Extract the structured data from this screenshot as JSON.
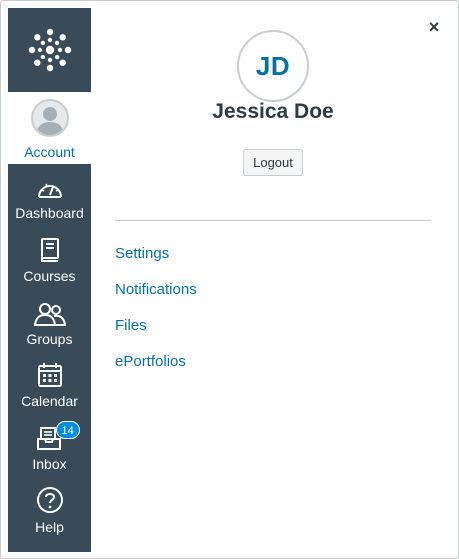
{
  "nav": {
    "account_label": "Account",
    "items": [
      {
        "label": "Dashboard",
        "icon": "dashboard-icon"
      },
      {
        "label": "Courses",
        "icon": "courses-icon"
      },
      {
        "label": "Groups",
        "icon": "groups-icon"
      },
      {
        "label": "Calendar",
        "icon": "calendar-icon"
      },
      {
        "label": "Inbox",
        "icon": "inbox-icon",
        "badge": "14"
      },
      {
        "label": "Help",
        "icon": "help-icon"
      }
    ],
    "colors": {
      "background": "#394b58",
      "accent": "#0770a3",
      "badge": "#008ee2"
    }
  },
  "tray": {
    "close_glyph": "×",
    "initials": "JD",
    "user_name": "Jessica Doe",
    "logout_label": "Logout",
    "links": [
      "Settings",
      "Notifications",
      "Files",
      "ePortfolios"
    ]
  }
}
